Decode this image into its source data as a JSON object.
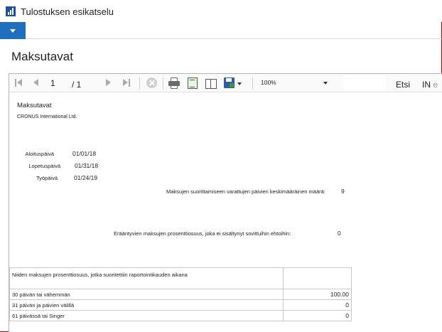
{
  "window": {
    "title": "Tulostuksen esikatselu"
  },
  "page": {
    "title": "Maksutavat"
  },
  "toolbar": {
    "page_current": "1",
    "page_total": "/ 1",
    "zoom": "100%",
    "find_label": "Etsi",
    "next_label_visible": "IN",
    "next_label_faded": "e"
  },
  "report": {
    "title": "Maksutavat",
    "company": "CRONUS International Ltd.",
    "fields": [
      {
        "label": "Aloituspäivä",
        "value": "01/01/18"
      },
      {
        "label": "Lopetuspäivä",
        "value": "01/31/18"
      },
      {
        "label": "Työpäivä",
        "value": "01/24/19"
      }
    ],
    "avg_days_label": "Maksujen suorittamiseen varattujen päivien keskimääräinen määrä:",
    "avg_days_value": "9",
    "overdue_label": "Erääntyvien maksujen prosenttiosuus, joka ei sisältynyt sovittuihin ehtoihin:",
    "overdue_value": "0",
    "table": {
      "header": "Niiden maksujen prosenttiosuus, jotka suoritettiin raportointikauden aikana",
      "rows": [
        {
          "label": "30 päivän tai vähemmän",
          "value": "100.00"
        },
        {
          "label": "31 päivän ja päivien välillä",
          "value": "0"
        },
        {
          "label": "61 päivässä tai Singer",
          "value": "0"
        }
      ]
    }
  }
}
